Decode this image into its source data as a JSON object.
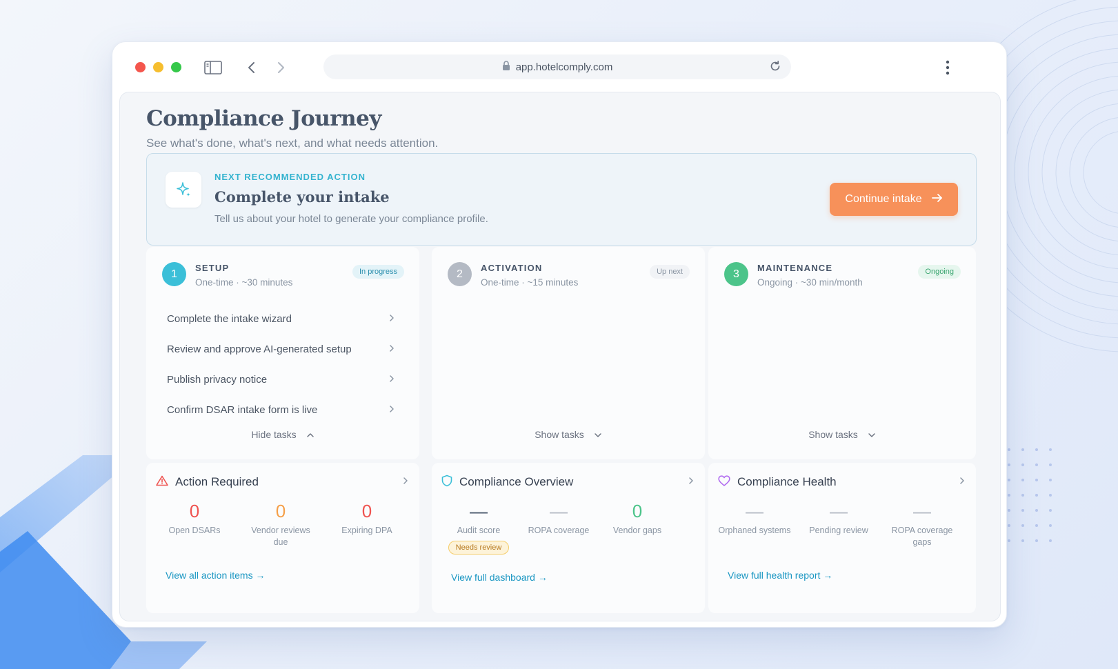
{
  "browser": {
    "url": "app.hotelcomply.com"
  },
  "page": {
    "title": "Compliance Journey",
    "subtitle": "See what's done, what's next, and what needs attention."
  },
  "recommendation": {
    "eyebrow": "NEXT RECOMMENDED ACTION",
    "title": "Complete your intake",
    "description": "Tell us about your hotel to generate your compliance profile.",
    "cta_label": "Continue intake"
  },
  "phases": [
    {
      "number": "1",
      "name": "SETUP",
      "meta": "One-time · ~30 minutes",
      "badge": "In progress",
      "toggle_label": "Hide tasks",
      "tasks": [
        "Complete the intake wizard",
        "Review and approve AI-generated setup",
        "Publish privacy notice",
        "Confirm DSAR intake form is live"
      ]
    },
    {
      "number": "2",
      "name": "ACTIVATION",
      "meta": "One-time · ~15 minutes",
      "badge": "Up next",
      "toggle_label": "Show tasks"
    },
    {
      "number": "3",
      "name": "MAINTENANCE",
      "meta": "Ongoing · ~30 min/month",
      "badge": "Ongoing",
      "toggle_label": "Show tasks"
    }
  ],
  "cards": {
    "action_required": {
      "title": "Action Required",
      "stats": [
        {
          "value": "0",
          "label": "Open DSARs"
        },
        {
          "value": "0",
          "label": "Vendor reviews due"
        },
        {
          "value": "0",
          "label": "Expiring DPA"
        }
      ],
      "link": "View all action items →"
    },
    "overview": {
      "title": "Compliance Overview",
      "stats": [
        {
          "value": "—",
          "label": "Audit score",
          "pill": "Needs review"
        },
        {
          "value": "—",
          "label": "ROPA coverage"
        },
        {
          "value": "0",
          "label": "Vendor gaps"
        }
      ],
      "link": "View full dashboard →"
    },
    "health": {
      "title": "Compliance Health",
      "stats": [
        {
          "value": "—",
          "label": "Orphaned systems"
        },
        {
          "value": "—",
          "label": "Pending review"
        },
        {
          "value": "—",
          "label": "ROPA coverage gaps"
        }
      ],
      "link": "View full health report →"
    }
  },
  "colors": {
    "accent_teal": "#3bbfd8",
    "cta_orange": "#f7915a",
    "danger_red": "#ef5350",
    "warning_orange": "#f5a04a",
    "success_green": "#4cc48a",
    "link_blue": "#1996c2",
    "phase_grey": "#b4bac4"
  }
}
